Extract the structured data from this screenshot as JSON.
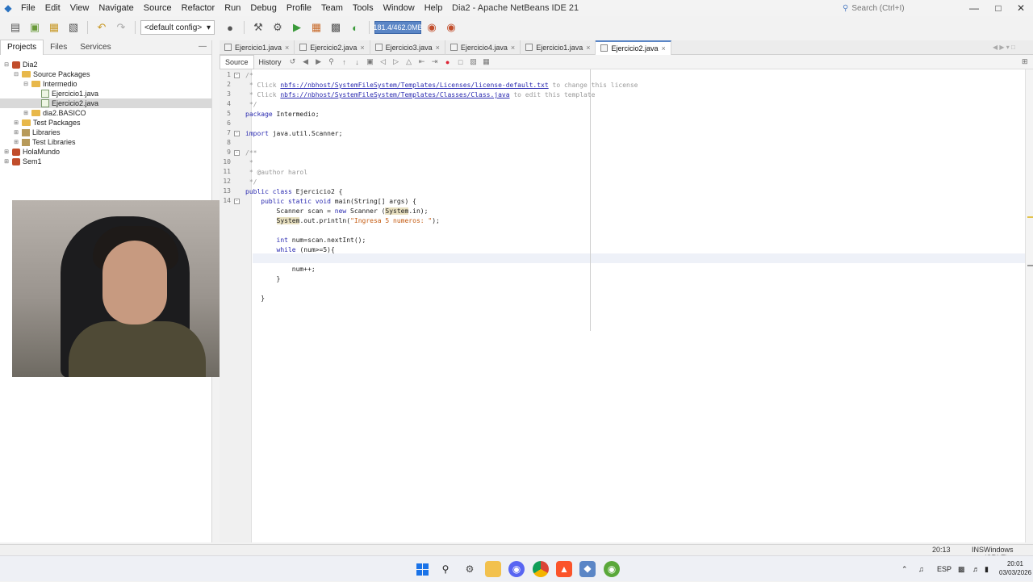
{
  "window": {
    "title": "Dia2 - Apache NetBeans IDE 21",
    "search_placeholder": "Search (Ctrl+I)",
    "menu": [
      "File",
      "Edit",
      "View",
      "Navigate",
      "Source",
      "Refactor",
      "Run",
      "Debug",
      "Profile",
      "Team",
      "Tools",
      "Window",
      "Help"
    ]
  },
  "toolbar": {
    "config": "<default config>",
    "memory": "181.4/462.0MB"
  },
  "panel": {
    "tabs": [
      "Projects",
      "Files",
      "Services"
    ],
    "tree": [
      {
        "label": "Dia2",
        "kind": "project",
        "level": 0,
        "toggle": "⊟"
      },
      {
        "label": "Source Packages",
        "kind": "folder",
        "level": 1,
        "toggle": "⊟"
      },
      {
        "label": "Intermedio",
        "kind": "folder",
        "level": 2,
        "toggle": "⊟"
      },
      {
        "label": "Ejercicio1.java",
        "kind": "java",
        "level": 3,
        "toggle": ""
      },
      {
        "label": "Ejercicio2.java",
        "kind": "java",
        "level": 3,
        "toggle": "",
        "selected": true
      },
      {
        "label": "dia2.BASICO",
        "kind": "folder",
        "level": 2,
        "toggle": "⊞"
      },
      {
        "label": "Test Packages",
        "kind": "folder",
        "level": 1,
        "toggle": "⊞"
      },
      {
        "label": "Libraries",
        "kind": "lib",
        "level": 1,
        "toggle": "⊞"
      },
      {
        "label": "Test Libraries",
        "kind": "lib",
        "level": 1,
        "toggle": "⊞"
      },
      {
        "label": "HolaMundo",
        "kind": "project",
        "level": 0,
        "toggle": "⊞"
      },
      {
        "label": "Sem1",
        "kind": "project",
        "level": 0,
        "toggle": "⊞"
      }
    ]
  },
  "editor": {
    "tabs": [
      "Ejercicio1.java",
      "Ejercicio2.java",
      "Ejercicio3.java",
      "Ejercicio4.java",
      "Ejercicio1.java",
      "Ejercicio2.java"
    ],
    "active_tab": 5,
    "view_tabs": [
      "Source",
      "History"
    ],
    "line_numbers": [
      "1",
      "2",
      "3",
      "4",
      "5",
      "6",
      "7",
      "8",
      "9",
      "10",
      "11",
      "12",
      "13",
      "14"
    ],
    "lines": [
      [
        {
          "t": "/*",
          "c": "cm"
        }
      ],
      [
        {
          "t": " * Click ",
          "c": "cm"
        },
        {
          "t": "nbfs://nbhost/SystemFileSystem/Templates/Licenses/license-default.txt",
          "c": "lnk"
        },
        {
          "t": " to change this license",
          "c": "cm"
        }
      ],
      [
        {
          "t": " * Click ",
          "c": "cm"
        },
        {
          "t": "nbfs://nbhost/SystemFileSystem/Templates/Classes/Class.java",
          "c": "lnk"
        },
        {
          "t": " to edit this template",
          "c": "cm"
        }
      ],
      [
        {
          "t": " */",
          "c": "cm"
        }
      ],
      [
        {
          "t": "package ",
          "c": "kw"
        },
        {
          "t": "Intermedio;",
          "c": ""
        }
      ],
      [],
      [
        {
          "t": "import ",
          "c": "kw"
        },
        {
          "t": "java.util.Scanner;",
          "c": ""
        }
      ],
      [],
      [
        {
          "t": "/**",
          "c": "cm"
        }
      ],
      [
        {
          "t": " *",
          "c": "cm"
        }
      ],
      [
        {
          "t": " * @author harol",
          "c": "cm"
        }
      ],
      [
        {
          "t": " */",
          "c": "cm"
        }
      ],
      [
        {
          "t": "public class ",
          "c": "kw"
        },
        {
          "t": "Ejercicio2 {",
          "c": ""
        }
      ],
      [
        {
          "t": "    public static void ",
          "c": "kw"
        },
        {
          "t": "main(String[] args) {",
          "c": ""
        }
      ],
      [
        {
          "t": "        Scanner scan = ",
          "c": ""
        },
        {
          "t": "new ",
          "c": "kw"
        },
        {
          "t": "Scanner (",
          "c": ""
        },
        {
          "t": "System",
          "c": "hl"
        },
        {
          "t": ".in);",
          "c": ""
        }
      ],
      [
        {
          "t": "        ",
          "c": ""
        },
        {
          "t": "System",
          "c": "hl"
        },
        {
          "t": ".out.println(",
          "c": ""
        },
        {
          "t": "\"Ingresa 5 numeros: \"",
          "c": "str"
        },
        {
          "t": ");",
          "c": ""
        }
      ],
      [],
      [
        {
          "t": "        int ",
          "c": "kw"
        },
        {
          "t": "num=scan.nextInt();",
          "c": ""
        }
      ],
      [
        {
          "t": "        while ",
          "c": "kw"
        },
        {
          "t": "(num>=5){",
          "c": ""
        }
      ],
      [],
      [
        {
          "t": "            num++;",
          "c": ""
        }
      ],
      [
        {
          "t": "        }",
          "c": ""
        }
      ],
      [],
      [
        {
          "t": "    }",
          "c": ""
        }
      ]
    ]
  },
  "status": {
    "position": "20:13",
    "mode": "INS",
    "line_endings": "Windows (CRLF)"
  },
  "taskbar": {
    "lang": "ESP",
    "time": "20:01",
    "date": "03/03/2026"
  }
}
